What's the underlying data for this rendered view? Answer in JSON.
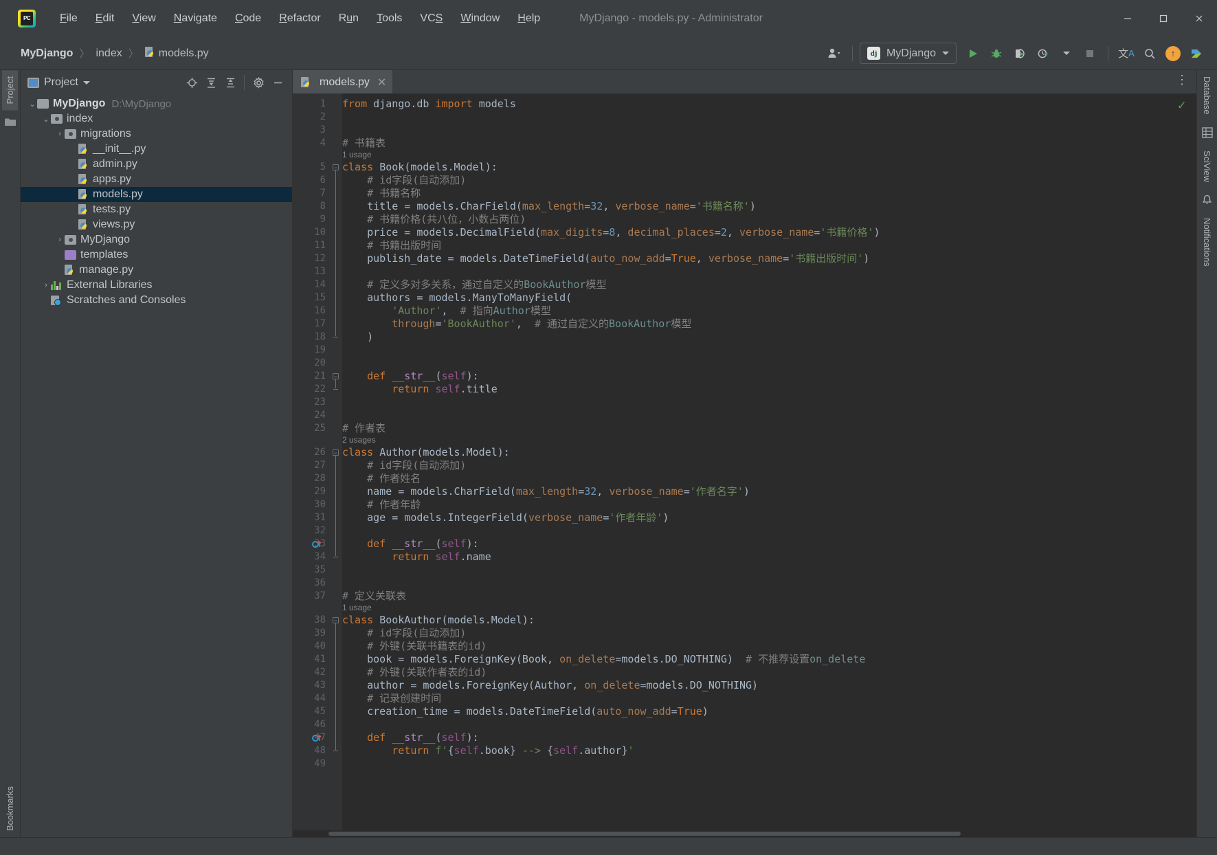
{
  "window": {
    "title": "MyDjango - models.py - Administrator",
    "logo_text": "PC",
    "minimize": "–",
    "maximize": "□",
    "close": "✕"
  },
  "menu": [
    {
      "pre": "",
      "key": "F",
      "post": "ile"
    },
    {
      "pre": "",
      "key": "E",
      "post": "dit"
    },
    {
      "pre": "",
      "key": "V",
      "post": "iew"
    },
    {
      "pre": "",
      "key": "N",
      "post": "avigate"
    },
    {
      "pre": "",
      "key": "C",
      "post": "ode"
    },
    {
      "pre": "",
      "key": "R",
      "post": "efactor"
    },
    {
      "pre": "R",
      "key": "u",
      "post": "n"
    },
    {
      "pre": "",
      "key": "T",
      "post": "ools"
    },
    {
      "pre": "VC",
      "key": "S",
      "post": ""
    },
    {
      "pre": "",
      "key": "W",
      "post": "indow"
    },
    {
      "pre": "",
      "key": "H",
      "post": "elp"
    }
  ],
  "breadcrumb": {
    "project": "MyDjango",
    "folder": "index",
    "file": "models.py",
    "separator": "〉"
  },
  "toolbar": {
    "run_config": "MyDjango",
    "dj_badge": "dj",
    "icons": {
      "account": "account-icon",
      "run": "run-icon",
      "debug": "debug-icon",
      "coverage": "coverage-icon",
      "profile": "profile-icon",
      "stop": "stop-icon",
      "translate": "translate-icon",
      "search": "search-icon",
      "update": "update-icon",
      "plugin": "plugin-icon"
    },
    "translate_glyph": "文",
    "translate_sub": "A",
    "update_glyph": "↑"
  },
  "left_rail": {
    "tabs": [
      "Project",
      "Bookmarks"
    ]
  },
  "right_rail": {
    "tabs": [
      "Database",
      "SciView",
      "Notifications"
    ]
  },
  "project_panel": {
    "title": "Project",
    "tools": [
      "locate-icon",
      "expand-all-icon",
      "collapse-all-icon",
      "settings-icon",
      "hide-icon"
    ],
    "tree": [
      {
        "depth": 0,
        "twisty": "⌄",
        "icon": "folder",
        "label": "MyDjango",
        "bold": true,
        "path": "D:\\MyDjango",
        "selected": false
      },
      {
        "depth": 1,
        "twisty": "⌄",
        "icon": "module",
        "label": "index",
        "bold": false,
        "path": "",
        "selected": false
      },
      {
        "depth": 2,
        "twisty": "›",
        "icon": "module",
        "label": "migrations",
        "bold": false,
        "path": "",
        "selected": false
      },
      {
        "depth": 3,
        "twisty": "",
        "icon": "python",
        "label": "__init__.py",
        "bold": false,
        "path": "",
        "selected": false
      },
      {
        "depth": 3,
        "twisty": "",
        "icon": "python",
        "label": "admin.py",
        "bold": false,
        "path": "",
        "selected": false
      },
      {
        "depth": 3,
        "twisty": "",
        "icon": "python",
        "label": "apps.py",
        "bold": false,
        "path": "",
        "selected": false
      },
      {
        "depth": 3,
        "twisty": "",
        "icon": "python",
        "label": "models.py",
        "bold": false,
        "path": "",
        "selected": true
      },
      {
        "depth": 3,
        "twisty": "",
        "icon": "python",
        "label": "tests.py",
        "bold": false,
        "path": "",
        "selected": false
      },
      {
        "depth": 3,
        "twisty": "",
        "icon": "python",
        "label": "views.py",
        "bold": false,
        "path": "",
        "selected": false
      },
      {
        "depth": 2,
        "twisty": "›",
        "icon": "module",
        "label": "MyDjango",
        "bold": false,
        "path": "",
        "selected": false
      },
      {
        "depth": 2,
        "twisty": "",
        "icon": "folder-purple",
        "label": "templates",
        "bold": false,
        "path": "",
        "selected": false
      },
      {
        "depth": 2,
        "twisty": "",
        "icon": "python",
        "label": "manage.py",
        "bold": false,
        "path": "",
        "selected": false
      },
      {
        "depth": 1,
        "twisty": "›",
        "icon": "library",
        "label": "External Libraries",
        "bold": false,
        "path": "",
        "selected": false
      },
      {
        "depth": 1,
        "twisty": "",
        "icon": "scratch",
        "label": "Scratches and Consoles",
        "bold": false,
        "path": "",
        "selected": false
      }
    ]
  },
  "editor": {
    "tab": {
      "label": "models.py",
      "close": "✕"
    },
    "more_glyph": "⋮",
    "inspection_ok": "✓",
    "total_lines": 49,
    "usage_hints": [
      {
        "above_line": 5,
        "text": "1 usage"
      },
      {
        "above_line": 26,
        "text": "2 usages"
      },
      {
        "above_line": 38,
        "text": "1 usage"
      }
    ],
    "lines": [
      {
        "n": 1,
        "tokens": [
          {
            "t": "from ",
            "c": "kw"
          },
          {
            "t": "django.db ",
            "c": "plain"
          },
          {
            "t": "import ",
            "c": "kw"
          },
          {
            "t": "models",
            "c": "plain"
          }
        ]
      },
      {
        "n": 2,
        "tokens": []
      },
      {
        "n": 3,
        "tokens": []
      },
      {
        "n": 4,
        "tokens": [
          {
            "t": "# 书籍表",
            "c": "cmt"
          }
        ]
      },
      {
        "n": 5,
        "tokens": [
          {
            "t": "class ",
            "c": "kw"
          },
          {
            "t": "Book",
            "c": "cls"
          },
          {
            "t": "(models.Model):",
            "c": "plain"
          }
        ]
      },
      {
        "n": 6,
        "tokens": [
          {
            "t": "    # id字段(自动添加)",
            "c": "cmt"
          }
        ]
      },
      {
        "n": 7,
        "tokens": [
          {
            "t": "    # 书籍名称",
            "c": "cmt"
          }
        ]
      },
      {
        "n": 8,
        "tokens": [
          {
            "t": "    title = models.CharField(",
            "c": "plain"
          },
          {
            "t": "max_length",
            "c": "kwarg"
          },
          {
            "t": "=",
            "c": "plain"
          },
          {
            "t": "32",
            "c": "num"
          },
          {
            "t": ", ",
            "c": "plain"
          },
          {
            "t": "verbose_name",
            "c": "kwarg"
          },
          {
            "t": "=",
            "c": "plain"
          },
          {
            "t": "'书籍名称'",
            "c": "str"
          },
          {
            "t": ")",
            "c": "plain"
          }
        ]
      },
      {
        "n": 9,
        "tokens": [
          {
            "t": "    # 书籍价格(共八位，小数占两位)",
            "c": "cmt"
          }
        ]
      },
      {
        "n": 10,
        "tokens": [
          {
            "t": "    price = models.DecimalField(",
            "c": "plain"
          },
          {
            "t": "max_digits",
            "c": "kwarg"
          },
          {
            "t": "=",
            "c": "plain"
          },
          {
            "t": "8",
            "c": "num"
          },
          {
            "t": ", ",
            "c": "plain"
          },
          {
            "t": "decimal_places",
            "c": "kwarg"
          },
          {
            "t": "=",
            "c": "plain"
          },
          {
            "t": "2",
            "c": "num"
          },
          {
            "t": ", ",
            "c": "plain"
          },
          {
            "t": "verbose_name",
            "c": "kwarg"
          },
          {
            "t": "=",
            "c": "plain"
          },
          {
            "t": "'书籍价格'",
            "c": "str"
          },
          {
            "t": ")",
            "c": "plain"
          }
        ]
      },
      {
        "n": 11,
        "tokens": [
          {
            "t": "    # 书籍出版时间",
            "c": "cmt"
          }
        ]
      },
      {
        "n": 12,
        "tokens": [
          {
            "t": "    publish_date = models.DateTimeField(",
            "c": "plain"
          },
          {
            "t": "auto_now_add",
            "c": "kwarg"
          },
          {
            "t": "=",
            "c": "plain"
          },
          {
            "t": "True",
            "c": "kw"
          },
          {
            "t": ", ",
            "c": "plain"
          },
          {
            "t": "verbose_name",
            "c": "kwarg"
          },
          {
            "t": "=",
            "c": "plain"
          },
          {
            "t": "'书籍出版时间'",
            "c": "str"
          },
          {
            "t": ")",
            "c": "plain"
          }
        ]
      },
      {
        "n": 13,
        "tokens": []
      },
      {
        "n": 14,
        "tokens": [
          {
            "t": "    # 定义多对多关系，通过自定义的",
            "c": "cmt"
          },
          {
            "t": "BookAuthor",
            "c": "cmt-id"
          },
          {
            "t": "模型",
            "c": "cmt"
          }
        ]
      },
      {
        "n": 15,
        "tokens": [
          {
            "t": "    authors = models.ManyToManyField(",
            "c": "plain"
          }
        ]
      },
      {
        "n": 16,
        "tokens": [
          {
            "t": "        ",
            "c": "plain"
          },
          {
            "t": "'Author'",
            "c": "str"
          },
          {
            "t": ",  ",
            "c": "plain"
          },
          {
            "t": "# 指向",
            "c": "cmt"
          },
          {
            "t": "Author",
            "c": "cmt-id"
          },
          {
            "t": "模型",
            "c": "cmt"
          }
        ]
      },
      {
        "n": 17,
        "tokens": [
          {
            "t": "        ",
            "c": "plain"
          },
          {
            "t": "through",
            "c": "kwarg"
          },
          {
            "t": "=",
            "c": "plain"
          },
          {
            "t": "'BookAuthor'",
            "c": "str"
          },
          {
            "t": ",  ",
            "c": "plain"
          },
          {
            "t": "# 通过自定义的",
            "c": "cmt"
          },
          {
            "t": "BookAuthor",
            "c": "cmt-id"
          },
          {
            "t": "模型",
            "c": "cmt"
          }
        ]
      },
      {
        "n": 18,
        "tokens": [
          {
            "t": "    )",
            "c": "plain"
          }
        ]
      },
      {
        "n": 19,
        "tokens": []
      },
      {
        "n": 20,
        "tokens": []
      },
      {
        "n": 21,
        "tokens": [
          {
            "t": "    ",
            "c": "plain"
          },
          {
            "t": "def ",
            "c": "kw"
          },
          {
            "t": "__str__",
            "c": "dunder"
          },
          {
            "t": "(",
            "c": "plain"
          },
          {
            "t": "self",
            "c": "self"
          },
          {
            "t": "):",
            "c": "plain"
          }
        ]
      },
      {
        "n": 22,
        "tokens": [
          {
            "t": "        ",
            "c": "plain"
          },
          {
            "t": "return ",
            "c": "kw"
          },
          {
            "t": "self",
            "c": "self"
          },
          {
            "t": ".title",
            "c": "plain"
          }
        ]
      },
      {
        "n": 23,
        "tokens": []
      },
      {
        "n": 24,
        "tokens": []
      },
      {
        "n": 25,
        "tokens": [
          {
            "t": "# 作者表",
            "c": "cmt"
          }
        ]
      },
      {
        "n": 26,
        "tokens": [
          {
            "t": "class ",
            "c": "kw"
          },
          {
            "t": "Author",
            "c": "cls"
          },
          {
            "t": "(models.Model):",
            "c": "plain"
          }
        ]
      },
      {
        "n": 27,
        "tokens": [
          {
            "t": "    # id字段(自动添加)",
            "c": "cmt"
          }
        ]
      },
      {
        "n": 28,
        "tokens": [
          {
            "t": "    # 作者姓名",
            "c": "cmt"
          }
        ]
      },
      {
        "n": 29,
        "tokens": [
          {
            "t": "    name = models.CharField(",
            "c": "plain"
          },
          {
            "t": "max_length",
            "c": "kwarg"
          },
          {
            "t": "=",
            "c": "plain"
          },
          {
            "t": "32",
            "c": "num"
          },
          {
            "t": ", ",
            "c": "plain"
          },
          {
            "t": "verbose_name",
            "c": "kwarg"
          },
          {
            "t": "=",
            "c": "plain"
          },
          {
            "t": "'作者名字'",
            "c": "str"
          },
          {
            "t": ")",
            "c": "plain"
          }
        ]
      },
      {
        "n": 30,
        "tokens": [
          {
            "t": "    # 作者年龄",
            "c": "cmt"
          }
        ]
      },
      {
        "n": 31,
        "tokens": [
          {
            "t": "    age = models.IntegerField(",
            "c": "plain"
          },
          {
            "t": "verbose_name",
            "c": "kwarg"
          },
          {
            "t": "=",
            "c": "plain"
          },
          {
            "t": "'作者年龄'",
            "c": "str"
          },
          {
            "t": ")",
            "c": "plain"
          }
        ]
      },
      {
        "n": 32,
        "tokens": []
      },
      {
        "n": 33,
        "tokens": [
          {
            "t": "    ",
            "c": "plain"
          },
          {
            "t": "def ",
            "c": "kw"
          },
          {
            "t": "__str__",
            "c": "dunder"
          },
          {
            "t": "(",
            "c": "plain"
          },
          {
            "t": "self",
            "c": "self"
          },
          {
            "t": "):",
            "c": "plain"
          }
        ]
      },
      {
        "n": 34,
        "tokens": [
          {
            "t": "        ",
            "c": "plain"
          },
          {
            "t": "return ",
            "c": "kw"
          },
          {
            "t": "self",
            "c": "self"
          },
          {
            "t": ".name",
            "c": "plain"
          }
        ]
      },
      {
        "n": 35,
        "tokens": []
      },
      {
        "n": 36,
        "tokens": []
      },
      {
        "n": 37,
        "tokens": [
          {
            "t": "# 定义关联表",
            "c": "cmt"
          }
        ]
      },
      {
        "n": 38,
        "tokens": [
          {
            "t": "class ",
            "c": "kw"
          },
          {
            "t": "BookAuthor",
            "c": "cls"
          },
          {
            "t": "(models.Model):",
            "c": "plain"
          }
        ]
      },
      {
        "n": 39,
        "tokens": [
          {
            "t": "    # id字段(自动添加)",
            "c": "cmt"
          }
        ]
      },
      {
        "n": 40,
        "tokens": [
          {
            "t": "    # 外键(关联书籍表的id)",
            "c": "cmt"
          }
        ]
      },
      {
        "n": 41,
        "tokens": [
          {
            "t": "    book = models.ForeignKey(Book, ",
            "c": "plain"
          },
          {
            "t": "on_delete",
            "c": "kwarg"
          },
          {
            "t": "=",
            "c": "plain"
          },
          {
            "t": "models.DO_NOTHING)",
            "c": "plain"
          },
          {
            "t": "  # 不推荐设置",
            "c": "cmt"
          },
          {
            "t": "on_delete",
            "c": "cmt-id"
          }
        ]
      },
      {
        "n": 42,
        "tokens": [
          {
            "t": "    # 外键(关联作者表的id)",
            "c": "cmt"
          }
        ]
      },
      {
        "n": 43,
        "tokens": [
          {
            "t": "    author = models.ForeignKey(Author, ",
            "c": "plain"
          },
          {
            "t": "on_delete",
            "c": "kwarg"
          },
          {
            "t": "=",
            "c": "plain"
          },
          {
            "t": "models.DO_NOTHING)",
            "c": "plain"
          }
        ]
      },
      {
        "n": 44,
        "tokens": [
          {
            "t": "    # 记录创建时间",
            "c": "cmt"
          }
        ]
      },
      {
        "n": 45,
        "tokens": [
          {
            "t": "    creation_time = models.DateTimeField(",
            "c": "plain"
          },
          {
            "t": "auto_now_add",
            "c": "kwarg"
          },
          {
            "t": "=",
            "c": "plain"
          },
          {
            "t": "True",
            "c": "kw"
          },
          {
            "t": ")",
            "c": "plain"
          }
        ]
      },
      {
        "n": 46,
        "tokens": []
      },
      {
        "n": 47,
        "tokens": [
          {
            "t": "    ",
            "c": "plain"
          },
          {
            "t": "def ",
            "c": "kw"
          },
          {
            "t": "__str__",
            "c": "dunder"
          },
          {
            "t": "(",
            "c": "plain"
          },
          {
            "t": "self",
            "c": "self"
          },
          {
            "t": "):",
            "c": "plain"
          }
        ]
      },
      {
        "n": 48,
        "tokens": [
          {
            "t": "        ",
            "c": "plain"
          },
          {
            "t": "return ",
            "c": "kw"
          },
          {
            "t": "f'",
            "c": "str"
          },
          {
            "t": "{",
            "c": "plain"
          },
          {
            "t": "self",
            "c": "self"
          },
          {
            "t": ".book",
            "c": "plain"
          },
          {
            "t": "}",
            "c": "plain"
          },
          {
            "t": " --> ",
            "c": "str"
          },
          {
            "t": "{",
            "c": "plain"
          },
          {
            "t": "self",
            "c": "self"
          },
          {
            "t": ".author",
            "c": "plain"
          },
          {
            "t": "}",
            "c": "plain"
          },
          {
            "t": "'",
            "c": "str"
          }
        ]
      },
      {
        "n": 49,
        "tokens": []
      }
    ],
    "override_markers": [
      33,
      47
    ]
  },
  "colors": {
    "accent_orange": "#cc7832",
    "string_green": "#6a8759",
    "number_blue": "#6897bb",
    "selection_blue": "#0d293e",
    "editor_bg": "#2b2b2b",
    "panel_bg": "#3c3f41"
  }
}
